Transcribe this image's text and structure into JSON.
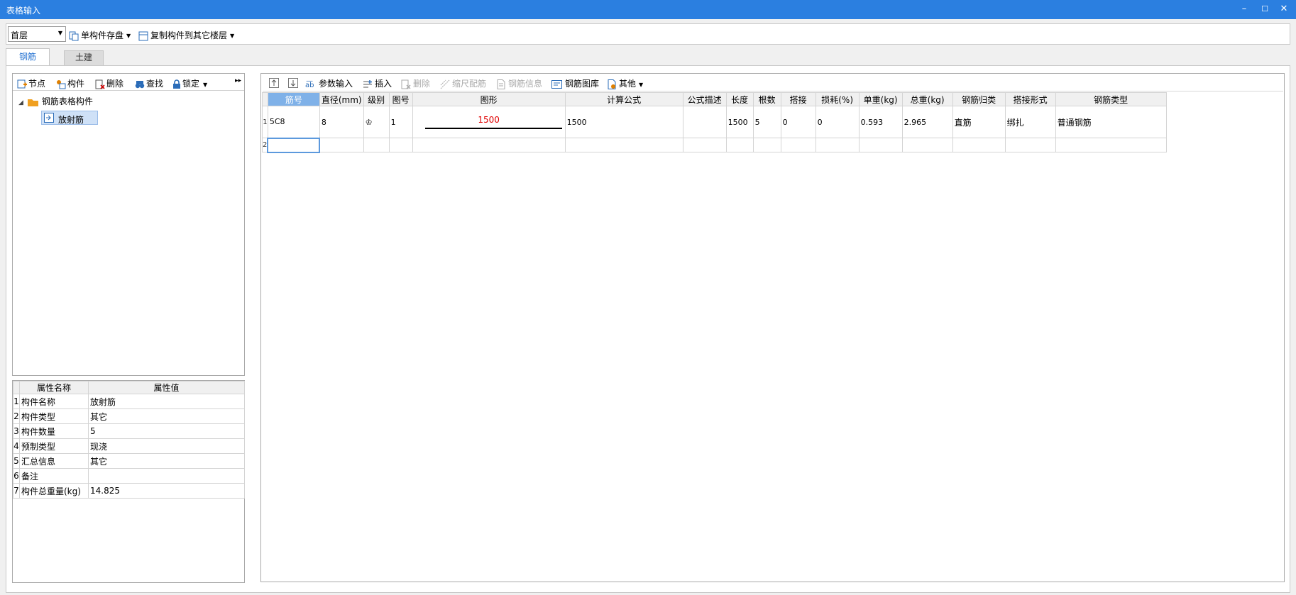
{
  "window": {
    "title": "表格输入",
    "min": "–",
    "max": "☐",
    "close": "✕"
  },
  "topbar": {
    "floor_value": "首层",
    "save_component": "单构件存盘",
    "copy_to_floors": "复制构件到其它楼层"
  },
  "tabs": [
    {
      "label": "钢筋"
    },
    {
      "label": "土建"
    }
  ],
  "left_toolbar": {
    "node": "节点",
    "component": "构件",
    "delete": "删除",
    "find": "查找",
    "lock": "锁定",
    "more": "▸▸"
  },
  "tree": {
    "root": "钢筋表格构件",
    "child": "放射筋"
  },
  "properties": {
    "headers": [
      "属性名称",
      "属性值"
    ],
    "rows": [
      {
        "n": "1",
        "name": "构件名称",
        "value": "放射筋"
      },
      {
        "n": "2",
        "name": "构件类型",
        "value": "其它"
      },
      {
        "n": "3",
        "name": "构件数量",
        "value": "5"
      },
      {
        "n": "4",
        "name": "预制类型",
        "value": "现浇"
      },
      {
        "n": "5",
        "name": "汇总信息",
        "value": "其它"
      },
      {
        "n": "6",
        "name": "备注",
        "value": ""
      },
      {
        "n": "7",
        "name": "构件总重量(kg)",
        "value": "14.825"
      }
    ]
  },
  "right_toolbar": {
    "param_input": "参数输入",
    "insert": "插入",
    "delete": "删除",
    "scale_rebar": "缩尺配筋",
    "rebar_info": "钢筋信息",
    "rebar_library": "钢筋图库",
    "other": "其他"
  },
  "grid": {
    "headers": [
      "筋号",
      "直径(mm)",
      "级别",
      "图号",
      "图形",
      "计算公式",
      "公式描述",
      "长度",
      "根数",
      "搭接",
      "损耗(%)",
      "单重(kg)",
      "总重(kg)",
      "钢筋归类",
      "搭接形式",
      "钢筋类型"
    ],
    "rows": [
      {
        "n": "1",
        "bar_no": "5C8",
        "diameter": "8",
        "grade": "♔",
        "fig_no": "1",
        "shape_value": "1500",
        "formula": "1500",
        "formula_desc": "",
        "length": "1500",
        "count": "5",
        "lap": "0",
        "loss": "0",
        "unit_weight": "0.593",
        "total_weight": "2.965",
        "category": "直筋",
        "lap_type": "绑扎",
        "rebar_type": "普通钢筋"
      }
    ],
    "new_row_num": "2"
  }
}
